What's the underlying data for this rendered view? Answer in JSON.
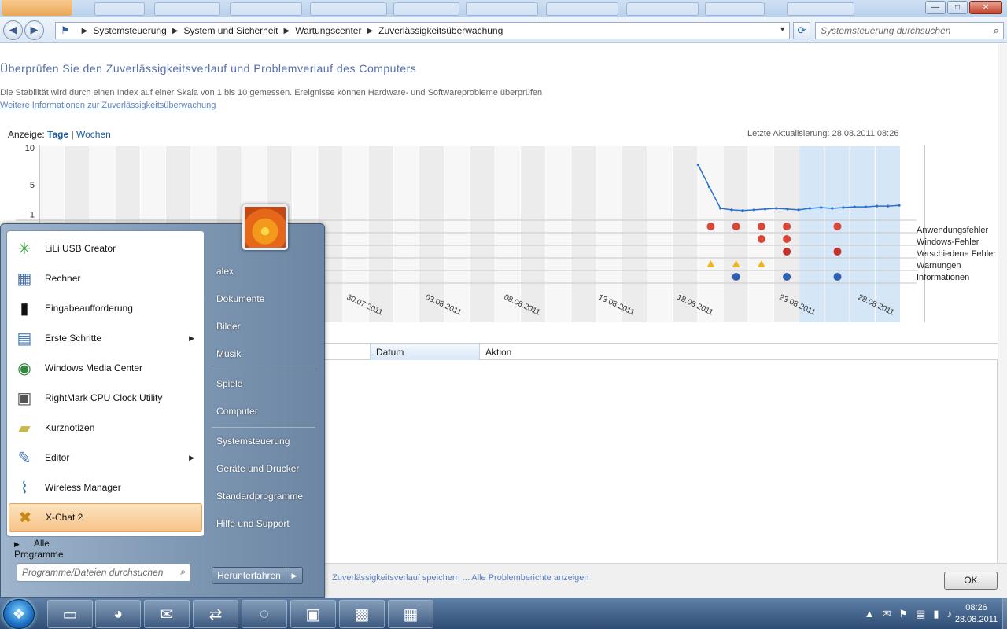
{
  "window": {
    "breadcrumb": [
      "Systemsteuerung",
      "System und Sicherheit",
      "Wartungscenter",
      "Zuverlässigkeitsüberwachung"
    ],
    "search_placeholder": "Systemsteuerung durchsuchen",
    "controls": {
      "minimize": "—",
      "maximize": "□",
      "close": "✕"
    }
  },
  "content": {
    "heading": "Überprüfen Sie den Zuverlässigkeitsverlauf und Problemverlauf des Computers",
    "description": "Die Stabilität wird durch einen Index auf einer Skala von 1 bis 10 gemessen. Ereignisse können Hardware- und Softwareprobleme überprüfen",
    "link_text": "Weitere Informationen zur Zuverlässigkeitsüberwachung",
    "view_label": "Anzeige:",
    "view_days": "Tage",
    "view_sep": "|",
    "view_weeks": "Wochen",
    "last_update": "Letzte Aktualisierung: 28.08.2011 08:26",
    "list_col_date": "Datum",
    "list_col_action": "Aktion",
    "bottom_link": "Zuverlässigkeitsverlauf speichern ... Alle Problemberichte anzeigen",
    "ok_label": "OK"
  },
  "chart_data": {
    "type": "line",
    "title": "",
    "ylim": [
      0,
      10
    ],
    "y_ticks": [
      "10",
      "5",
      "1"
    ],
    "x": [
      0,
      1,
      2,
      3,
      4,
      5,
      6,
      7,
      8,
      9,
      10,
      11,
      12,
      13,
      14,
      15,
      16,
      17,
      18
    ],
    "series": [
      {
        "name": "",
        "values": [
          7.5,
          4.5,
          1.6,
          1.4,
          1.3,
          1.4,
          1.5,
          1.6,
          1.5,
          1.4,
          1.6,
          1.7,
          1.6,
          1.7,
          1.8,
          1.8,
          1.9,
          1.9,
          2.0
        ]
      }
    ],
    "legend": [
      "Anwendungsfehler",
      "Windows-Fehler",
      "Verschiedene Fehler",
      "Warnungen",
      "Informationen"
    ],
    "x_labels": [
      "30.07.2011",
      "03.08.2011",
      "08.08.2011",
      "13.08.2011",
      "18.08.2011",
      "23.08.2011",
      "28.08.2011"
    ]
  },
  "start_menu": {
    "programs": [
      {
        "label": "LiLi USB Creator",
        "icon": "lili-icon",
        "glyph": "✳",
        "color": "#3a9a3a",
        "arrow": false,
        "highlight": false
      },
      {
        "label": "Rechner",
        "icon": "calculator-icon",
        "glyph": "▦",
        "color": "#4a6fa5",
        "arrow": false,
        "highlight": false
      },
      {
        "label": "Eingabeaufforderung",
        "icon": "cmd-icon",
        "glyph": "▮",
        "color": "#111111",
        "arrow": false,
        "highlight": false
      },
      {
        "label": "Erste Schritte",
        "icon": "getting-started-icon",
        "glyph": "▤",
        "color": "#3f7fbf",
        "arrow": true,
        "highlight": false
      },
      {
        "label": "Windows Media Center",
        "icon": "media-center-icon",
        "glyph": "◉",
        "color": "#2f8a3a",
        "arrow": false,
        "highlight": false
      },
      {
        "label": "RightMark CPU Clock Utility",
        "icon": "cpu-clock-icon",
        "glyph": "▣",
        "color": "#555555",
        "arrow": false,
        "highlight": false
      },
      {
        "label": "Kurznotizen",
        "icon": "sticky-notes-icon",
        "glyph": "▰",
        "color": "#c7b84a",
        "arrow": false,
        "highlight": false
      },
      {
        "label": "Editor",
        "icon": "notepad-icon",
        "glyph": "✎",
        "color": "#3c78b4",
        "arrow": true,
        "highlight": false
      },
      {
        "label": "Wireless Manager",
        "icon": "wireless-icon",
        "glyph": "⌇",
        "color": "#2a6aa6",
        "arrow": false,
        "highlight": false
      },
      {
        "label": "X-Chat 2",
        "icon": "xchat-icon",
        "glyph": "✖",
        "color": "#c98a12",
        "arrow": false,
        "highlight": true
      }
    ],
    "all_programs": "Alle Programme",
    "search_placeholder": "Programme/Dateien durchsuchen",
    "places": [
      "alex",
      "Dokumente",
      "Bilder",
      "Musik",
      "Spiele",
      "Computer",
      "Systemsteuerung",
      "Geräte und Drucker",
      "Standardprogramme",
      "Hilfe und Support"
    ],
    "shutdown_label": "Herunterfahren"
  },
  "taskbar": {
    "pinned": [
      {
        "name": "explorer-icon",
        "glyph": "▭"
      },
      {
        "name": "firefox-icon",
        "glyph": "◕"
      },
      {
        "name": "thunderbird-icon",
        "glyph": "✉"
      },
      {
        "name": "network-icon",
        "glyph": "⇄"
      },
      {
        "name": "debian-icon",
        "glyph": "◌"
      },
      {
        "name": "remote-desktop-icon",
        "glyph": "▣"
      },
      {
        "name": "cpuz-icon",
        "glyph": "▩"
      },
      {
        "name": "control-panel-icon",
        "glyph": "▦"
      }
    ],
    "tray": [
      "▲",
      "✉",
      "⚑",
      "▤",
      "▮",
      "♪"
    ],
    "time": "08:26",
    "date": "28.08.2011"
  }
}
